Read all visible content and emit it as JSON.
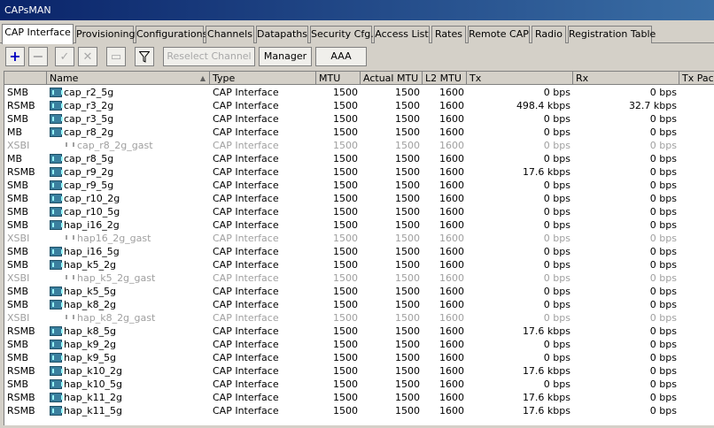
{
  "window": {
    "title": "CAPsMAN"
  },
  "tabs": [
    {
      "label": "CAP Interface",
      "active": true
    },
    {
      "label": "Provisioning"
    },
    {
      "label": "Configurations"
    },
    {
      "label": "Channels"
    },
    {
      "label": "Datapaths"
    },
    {
      "label": "Security Cfg."
    },
    {
      "label": "Access List"
    },
    {
      "label": "Rates"
    },
    {
      "label": "Remote CAP"
    },
    {
      "label": "Radio"
    },
    {
      "label": "Registration Table"
    }
  ],
  "toolbar": {
    "add_icon": "plus-icon",
    "remove_icon": "minus-icon",
    "enable_icon": "check-icon",
    "disable_icon": "cross-icon",
    "comment_icon": "comment-icon",
    "filter_icon": "filter-icon",
    "reselect_label": "Reselect Channel",
    "manager_label": "Manager",
    "aaa_label": "AAA"
  },
  "table": {
    "columns": [
      "",
      "Name",
      "Type",
      "MTU",
      "Actual MTU",
      "L2 MTU",
      "Tx",
      "Rx",
      "Tx Pack"
    ],
    "sort_indicator": "▲",
    "rows": [
      {
        "flags": "SMB",
        "name": "cap_r2_5g",
        "type": "CAP Interface",
        "mtu": "1500",
        "actual_mtu": "1500",
        "l2_mtu": "1600",
        "tx": "0 bps",
        "rx": "0 bps",
        "disabled": false
      },
      {
        "flags": "RSMB",
        "name": "cap_r3_2g",
        "type": "CAP Interface",
        "mtu": "1500",
        "actual_mtu": "1500",
        "l2_mtu": "1600",
        "tx": "498.4 kbps",
        "rx": "32.7 kbps",
        "disabled": false
      },
      {
        "flags": "SMB",
        "name": "cap_r3_5g",
        "type": "CAP Interface",
        "mtu": "1500",
        "actual_mtu": "1500",
        "l2_mtu": "1600",
        "tx": "0 bps",
        "rx": "0 bps",
        "disabled": false
      },
      {
        "flags": "MB",
        "name": "cap_r8_2g",
        "type": "CAP Interface",
        "mtu": "1500",
        "actual_mtu": "1500",
        "l2_mtu": "1600",
        "tx": "0 bps",
        "rx": "0 bps",
        "disabled": false
      },
      {
        "flags": "XSBI",
        "name": "cap_r8_2g_gast",
        "type": "CAP Interface",
        "mtu": "1500",
        "actual_mtu": "1500",
        "l2_mtu": "1600",
        "tx": "0 bps",
        "rx": "0 bps",
        "disabled": true
      },
      {
        "flags": "MB",
        "name": "cap_r8_5g",
        "type": "CAP Interface",
        "mtu": "1500",
        "actual_mtu": "1500",
        "l2_mtu": "1600",
        "tx": "0 bps",
        "rx": "0 bps",
        "disabled": false
      },
      {
        "flags": "RSMB",
        "name": "cap_r9_2g",
        "type": "CAP Interface",
        "mtu": "1500",
        "actual_mtu": "1500",
        "l2_mtu": "1600",
        "tx": "17.6 kbps",
        "rx": "0 bps",
        "disabled": false
      },
      {
        "flags": "SMB",
        "name": "cap_r9_5g",
        "type": "CAP Interface",
        "mtu": "1500",
        "actual_mtu": "1500",
        "l2_mtu": "1600",
        "tx": "0 bps",
        "rx": "0 bps",
        "disabled": false
      },
      {
        "flags": "SMB",
        "name": "cap_r10_2g",
        "type": "CAP Interface",
        "mtu": "1500",
        "actual_mtu": "1500",
        "l2_mtu": "1600",
        "tx": "0 bps",
        "rx": "0 bps",
        "disabled": false
      },
      {
        "flags": "SMB",
        "name": "cap_r10_5g",
        "type": "CAP Interface",
        "mtu": "1500",
        "actual_mtu": "1500",
        "l2_mtu": "1600",
        "tx": "0 bps",
        "rx": "0 bps",
        "disabled": false
      },
      {
        "flags": "SMB",
        "name": "hap_i16_2g",
        "type": "CAP Interface",
        "mtu": "1500",
        "actual_mtu": "1500",
        "l2_mtu": "1600",
        "tx": "0 bps",
        "rx": "0 bps",
        "disabled": false
      },
      {
        "flags": "XSBI",
        "name": "hap16_2g_gast",
        "type": "CAP Interface",
        "mtu": "1500",
        "actual_mtu": "1500",
        "l2_mtu": "1600",
        "tx": "0 bps",
        "rx": "0 bps",
        "disabled": true
      },
      {
        "flags": "SMB",
        "name": "hap_i16_5g",
        "type": "CAP Interface",
        "mtu": "1500",
        "actual_mtu": "1500",
        "l2_mtu": "1600",
        "tx": "0 bps",
        "rx": "0 bps",
        "disabled": false
      },
      {
        "flags": "SMB",
        "name": "hap_k5_2g",
        "type": "CAP Interface",
        "mtu": "1500",
        "actual_mtu": "1500",
        "l2_mtu": "1600",
        "tx": "0 bps",
        "rx": "0 bps",
        "disabled": false
      },
      {
        "flags": "XSBI",
        "name": "hap_k5_2g_gast",
        "type": "CAP Interface",
        "mtu": "1500",
        "actual_mtu": "1500",
        "l2_mtu": "1600",
        "tx": "0 bps",
        "rx": "0 bps",
        "disabled": true
      },
      {
        "flags": "SMB",
        "name": "hap_k5_5g",
        "type": "CAP Interface",
        "mtu": "1500",
        "actual_mtu": "1500",
        "l2_mtu": "1600",
        "tx": "0 bps",
        "rx": "0 bps",
        "disabled": false
      },
      {
        "flags": "SMB",
        "name": "hap_k8_2g",
        "type": "CAP Interface",
        "mtu": "1500",
        "actual_mtu": "1500",
        "l2_mtu": "1600",
        "tx": "0 bps",
        "rx": "0 bps",
        "disabled": false
      },
      {
        "flags": "XSBI",
        "name": "hap_k8_2g_gast",
        "type": "CAP Interface",
        "mtu": "1500",
        "actual_mtu": "1500",
        "l2_mtu": "1600",
        "tx": "0 bps",
        "rx": "0 bps",
        "disabled": true
      },
      {
        "flags": "RSMB",
        "name": "hap_k8_5g",
        "type": "CAP Interface",
        "mtu": "1500",
        "actual_mtu": "1500",
        "l2_mtu": "1600",
        "tx": "17.6 kbps",
        "rx": "0 bps",
        "disabled": false
      },
      {
        "flags": "SMB",
        "name": "hap_k9_2g",
        "type": "CAP Interface",
        "mtu": "1500",
        "actual_mtu": "1500",
        "l2_mtu": "1600",
        "tx": "0 bps",
        "rx": "0 bps",
        "disabled": false
      },
      {
        "flags": "SMB",
        "name": "hap_k9_5g",
        "type": "CAP Interface",
        "mtu": "1500",
        "actual_mtu": "1500",
        "l2_mtu": "1600",
        "tx": "0 bps",
        "rx": "0 bps",
        "disabled": false
      },
      {
        "flags": "RSMB",
        "name": "hap_k10_2g",
        "type": "CAP Interface",
        "mtu": "1500",
        "actual_mtu": "1500",
        "l2_mtu": "1600",
        "tx": "17.6 kbps",
        "rx": "0 bps",
        "disabled": false
      },
      {
        "flags": "SMB",
        "name": "hap_k10_5g",
        "type": "CAP Interface",
        "mtu": "1500",
        "actual_mtu": "1500",
        "l2_mtu": "1600",
        "tx": "0 bps",
        "rx": "0 bps",
        "disabled": false
      },
      {
        "flags": "RSMB",
        "name": "hap_k11_2g",
        "type": "CAP Interface",
        "mtu": "1500",
        "actual_mtu": "1500",
        "l2_mtu": "1600",
        "tx": "17.6 kbps",
        "rx": "0 bps",
        "disabled": false
      },
      {
        "flags": "RSMB",
        "name": "hap_k11_5g",
        "type": "CAP Interface",
        "mtu": "1500",
        "actual_mtu": "1500",
        "l2_mtu": "1600",
        "tx": "17.6 kbps",
        "rx": "0 bps",
        "disabled": false
      }
    ]
  }
}
